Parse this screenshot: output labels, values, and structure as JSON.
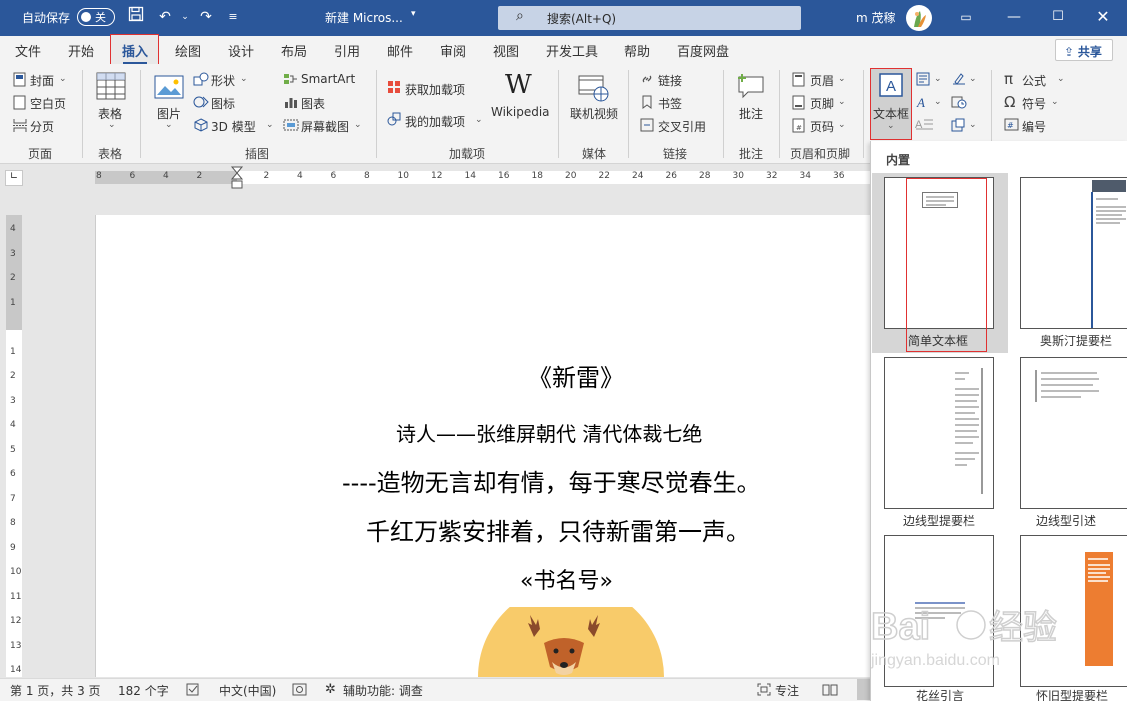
{
  "titlebar": {
    "autosave_label": "自动保存",
    "autosave_state": "关",
    "doc_title": "新建 Micros...",
    "search_placeholder": "搜索(Alt+Q)",
    "user_name": "m 茂稼"
  },
  "tabs": [
    "文件",
    "开始",
    "插入",
    "绘图",
    "设计",
    "布局",
    "引用",
    "邮件",
    "审阅",
    "视图",
    "开发工具",
    "帮助",
    "百度网盘"
  ],
  "active_tab": "插入",
  "share_label": "共享",
  "ribbon": {
    "pages": {
      "cover": "封面",
      "blank": "空白页",
      "break": "分页",
      "group": "页面"
    },
    "tables": {
      "table": "表格",
      "group": "表格"
    },
    "illustrations": {
      "picture": "图片",
      "shapes": "形状",
      "icons": "图标",
      "model3d": "3D 模型",
      "smartart": "SmartArt",
      "chart": "图表",
      "screenshot": "屏幕截图",
      "group": "插图"
    },
    "addins": {
      "get": "获取加载项",
      "mine": "我的加载项",
      "wikipedia": "Wikipedia",
      "group": "加载项"
    },
    "media": {
      "video": "联机视频",
      "group": "媒体"
    },
    "links": {
      "link": "链接",
      "bookmark": "书签",
      "crossref": "交叉引用",
      "group": "链接"
    },
    "comments": {
      "comment": "批注",
      "group": "批注"
    },
    "headerfooter": {
      "header": "页眉",
      "footer": "页脚",
      "pagenum": "页码",
      "group": "页眉和页脚"
    },
    "text": {
      "textbox": "文本框"
    },
    "symbols": {
      "equation": "公式",
      "symbol": "符号",
      "number": "编号"
    }
  },
  "document": {
    "title": "《新雷》",
    "author": "诗人——张维屏朝代 清代体裁七绝",
    "line1": "----造物无言却有情，每于寒尽觉春生。",
    "line2": "千红万紫安排着，只待新雷第一声。",
    "line3": "«书名号»"
  },
  "status": {
    "page": "第 1 页，共 3 页",
    "words": "182 个字",
    "language": "中文(中国)",
    "accessibility": "辅助功能: 调查",
    "focus": "专注"
  },
  "panel": {
    "section": "内置",
    "items": [
      "简单文本框",
      "奥斯汀提要栏",
      "边线型提要栏",
      "边线型引述",
      "花丝引言",
      "怀旧型提要栏"
    ]
  },
  "ruler_numbers": [
    "8",
    "6",
    "4",
    "2",
    "",
    "2",
    "4",
    "6",
    "8",
    "10",
    "12",
    "14",
    "16",
    "18",
    "20",
    "22",
    "24",
    "26",
    "28",
    "30",
    "32",
    "34",
    "36"
  ],
  "vruler_numbers": [
    "4",
    "3",
    "2",
    "1",
    "",
    "1",
    "2",
    "3",
    "4",
    "5",
    "6",
    "7",
    "8",
    "9",
    "10",
    "11",
    "12",
    "13",
    "14"
  ],
  "colors": {
    "brand": "#2b579a",
    "highlight": "#e03131",
    "cover_orange": "#ed7d31"
  }
}
